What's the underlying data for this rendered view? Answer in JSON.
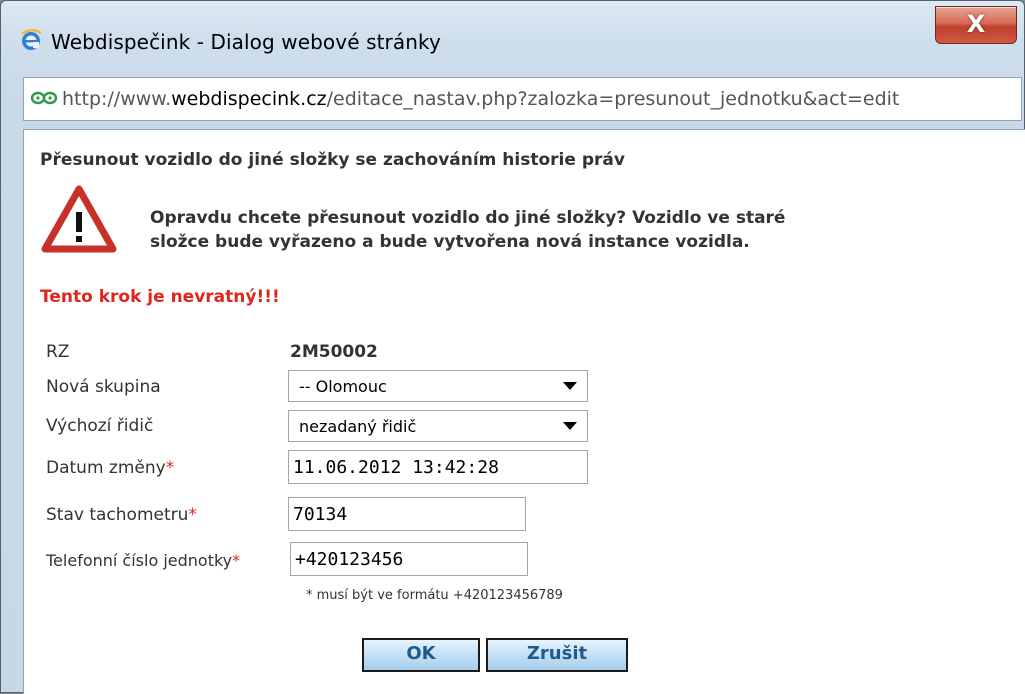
{
  "window": {
    "title": "Webdispečink - Dialog webové stránky",
    "close_label": "X"
  },
  "address": {
    "url_prefix": "http://www.",
    "url_domain": "webdispecink.cz",
    "url_rest": "/editace_nastav.php?zalozka=presunout_jednotku&act=edit"
  },
  "dialog": {
    "heading": "Přesunout vozidlo do jiné složky se zachováním historie práv",
    "warning_line1": "Opravdu chcete přesunout vozidlo do jiné složky? Vozidlo ve staré",
    "warning_line2": "složce bude vyřazeno a bude vytvořena nová instance vozidla.",
    "irreversible": "Tento krok je nevratný!!!"
  },
  "form": {
    "rz_label": "RZ",
    "rz_value": "2M50002",
    "group_label": "Nová skupina",
    "group_value": "-- Olomouc",
    "driver_label": "Výchozí řidič",
    "driver_value": "nezadaný řidič",
    "date_label": "Datum změny",
    "date_value": "11.06.2012 13:42:28",
    "odometer_label": "Stav tachometru",
    "odometer_value": "70134",
    "phone_label": "Telefonní číslo jednotky",
    "phone_value": "+420123456",
    "required_mark": "*",
    "format_note": "* musí být ve formátu +420123456789"
  },
  "buttons": {
    "ok": "OK",
    "cancel": "Zrušit"
  },
  "icons": {
    "app": "ie-icon",
    "site": "webdispecink-site-icon",
    "warning": "warning-icon"
  },
  "colors": {
    "required": "#e0261b",
    "button_text": "#1f5a8c",
    "close_button": "#c0402b"
  }
}
